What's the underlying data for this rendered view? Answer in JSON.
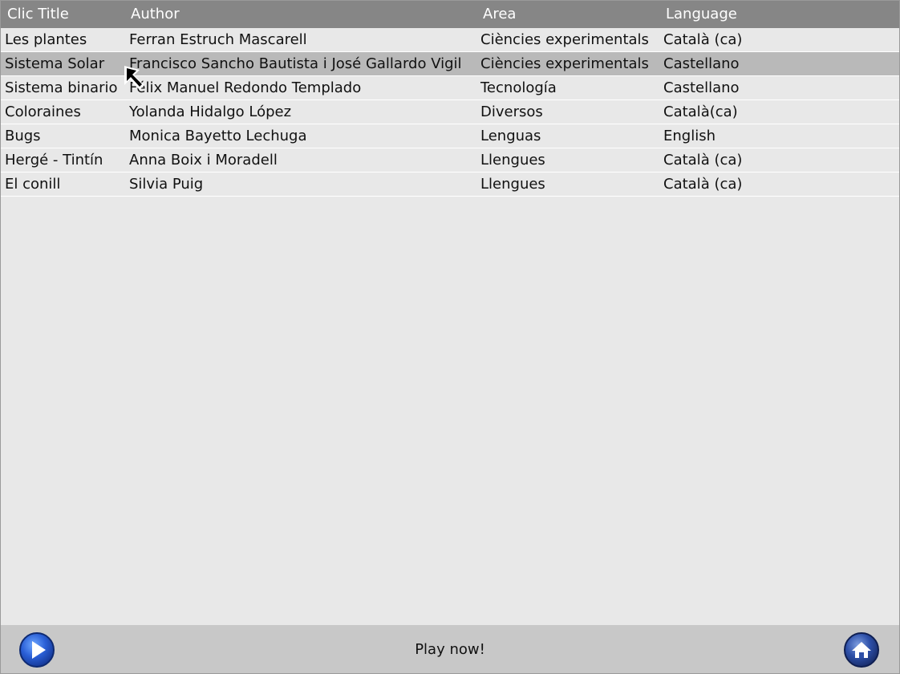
{
  "columns": {
    "title": "Clic Title",
    "author": "Author",
    "area": "Area",
    "language": "Language"
  },
  "rows": [
    {
      "title": "Les plantes",
      "author": "Ferran Estruch Mascarell",
      "area": "Ciències experimentals",
      "language": "Català (ca)",
      "selected": false
    },
    {
      "title": "Sistema Solar",
      "author": "Francisco Sancho Bautista i José Gallardo Vigil",
      "area": "Ciències experimentals",
      "language": "Castellano",
      "selected": true
    },
    {
      "title": "Sistema binario",
      "author": "Félix Manuel Redondo Templado",
      "area": "Tecnología",
      "language": "Castellano",
      "selected": false
    },
    {
      "title": "Coloraines",
      "author": "Yolanda Hidalgo López",
      "area": "Diversos",
      "language": "Català(ca)",
      "selected": false
    },
    {
      "title": "Bugs",
      "author": "Monica Bayetto Lechuga",
      "area": "Lenguas",
      "language": "English",
      "selected": false
    },
    {
      "title": "Hergé - Tintín",
      "author": "Anna Boix i Moradell",
      "area": "Llengues",
      "language": "Català (ca)",
      "selected": false
    },
    {
      "title": "El conill",
      "author": "Silvia Puig",
      "area": "Llengues",
      "language": "Català (ca)",
      "selected": false
    }
  ],
  "footer": {
    "play_label": "Play now!",
    "play_icon": "play-icon",
    "home_icon": "home-icon"
  },
  "colors": {
    "header_bg": "#868686",
    "selected_row_bg": "#b9b9b9",
    "list_bg": "#e8e8e8",
    "footer_bg": "#c8c8c8",
    "button_blue": "#1f4fc4"
  }
}
